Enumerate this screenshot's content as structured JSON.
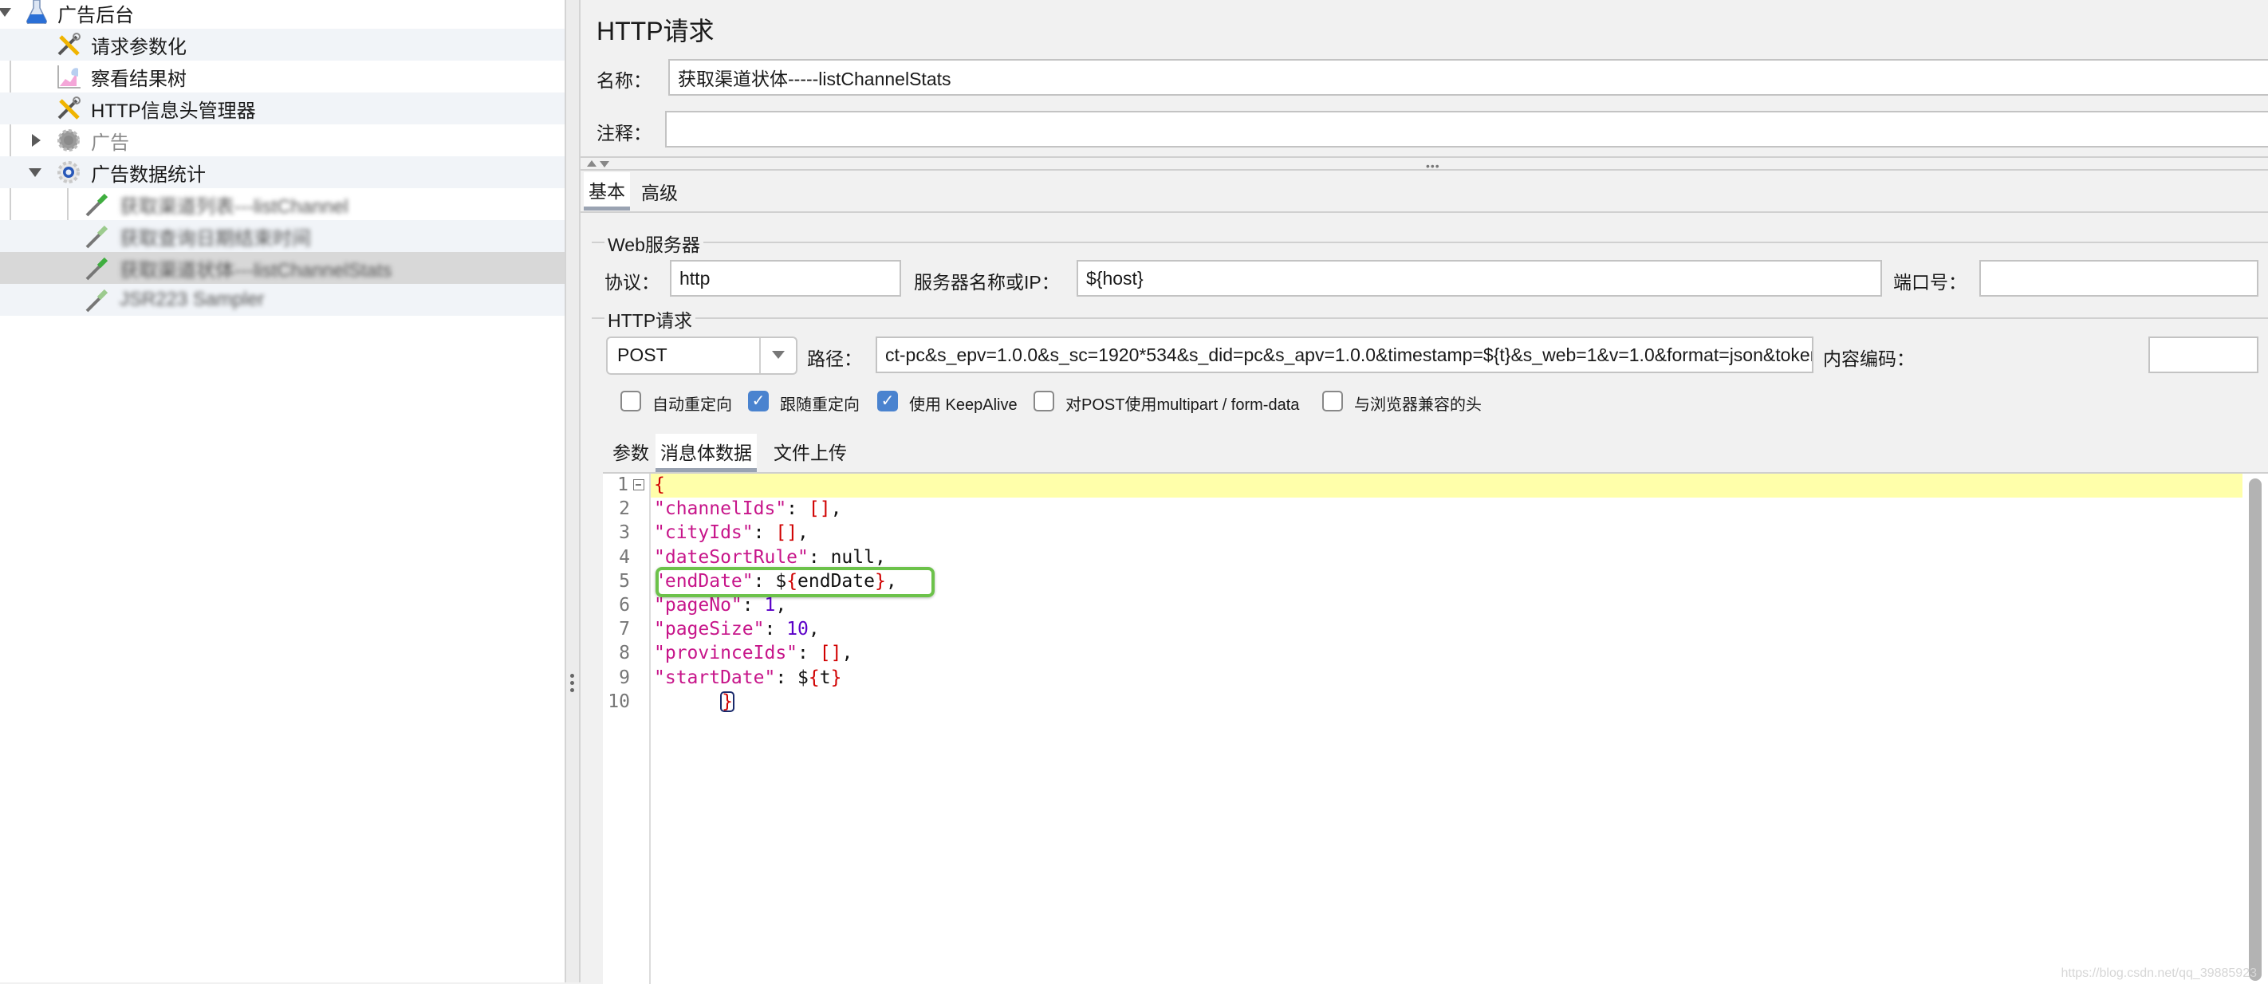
{
  "tree": {
    "items": [
      {
        "label": "广告后台",
        "icon": "test-plan-flask-icon",
        "expanded": true
      },
      {
        "label": "请求参数化",
        "icon": "config-tools-icon"
      },
      {
        "label": "察看结果树",
        "icon": "listener-graph-icon"
      },
      {
        "label": "HTTP信息头管理器",
        "icon": "config-tools-icon"
      },
      {
        "label": "广告",
        "icon": "thread-group-gear-icon",
        "expanded": false,
        "disabled": true
      },
      {
        "label": "广告数据统计",
        "icon": "thread-group-gear-icon",
        "expanded": true
      },
      {
        "label": "获取渠道列表---listChannel",
        "icon": "sampler-pipette-icon",
        "blurred": true
      },
      {
        "label": "获取查询日期结束时间",
        "icon": "sampler-pipette-icon",
        "blurred": true
      },
      {
        "label": "获取渠道状体---listChannelStats",
        "icon": "sampler-pipette-icon",
        "blurred": true,
        "selected": true
      },
      {
        "label": "JSR223 Sampler",
        "icon": "sampler-pipette-icon",
        "blurred": true
      }
    ]
  },
  "panel": {
    "title": "HTTP请求",
    "name_label": "名称：",
    "name_value": "获取渠道状体-----listChannelStats",
    "comment_label": "注释：",
    "comment_value": "",
    "tabs": [
      {
        "label": "基本",
        "active": true
      },
      {
        "label": "高级",
        "active": false
      }
    ],
    "web_server": {
      "group_title": "Web服务器",
      "protocol_label": "协议：",
      "protocol_value": "http",
      "server_label": "服务器名称或IP：",
      "server_value": "${host}",
      "port_label": "端口号：",
      "port_value": ""
    },
    "http_request": {
      "group_title": "HTTP请求",
      "method": "POST",
      "path_label": "路径：",
      "path_value": "ct-pc&s_epv=1.0.0&s_sc=1920*534&s_did=pc&s_apv=1.0.0&timestamp=${t}&s_web=1&v=1.0&format=json&token=${token}&_t=${t}",
      "encoding_label": "内容编码：",
      "encoding_value": ""
    },
    "options": [
      {
        "label": "自动重定向",
        "checked": false
      },
      {
        "label": "跟随重定向",
        "checked": true
      },
      {
        "label": "使用 KeepAlive",
        "checked": true
      },
      {
        "label": "对POST使用multipart / form-data",
        "checked": false
      },
      {
        "label": "与浏览器兼容的头",
        "checked": false
      }
    ],
    "body_tabs": [
      {
        "label": "参数",
        "active": false
      },
      {
        "label": "消息体数据",
        "active": true
      },
      {
        "label": "文件上传",
        "active": false
      }
    ],
    "body_lines": [
      "{",
      "\"channelIds\": [],",
      "\"cityIds\": [],",
      "\"dateSortRule\": null,",
      "\"endDate\": ${endDate},",
      "\"pageNo\": 1,",
      "\"pageSize\": 10,",
      "\"provinceIds\": [],",
      "\"startDate\": ${t}",
      "      }"
    ],
    "line_numbers": [
      "1",
      "2",
      "3",
      "4",
      "5",
      "6",
      "7",
      "8",
      "9",
      "10"
    ],
    "watermark": "https://blog.csdn.net/qq_39885923"
  },
  "colors": {
    "json_key": "#c7158a",
    "json_punct": "#d00000",
    "json_number": "#5b00c8",
    "json_keyword": "#0000d0",
    "highlight_line": "#ffffaa",
    "annotation_box": "#6cc24a",
    "checkbox_checked": "#4a83cf"
  }
}
